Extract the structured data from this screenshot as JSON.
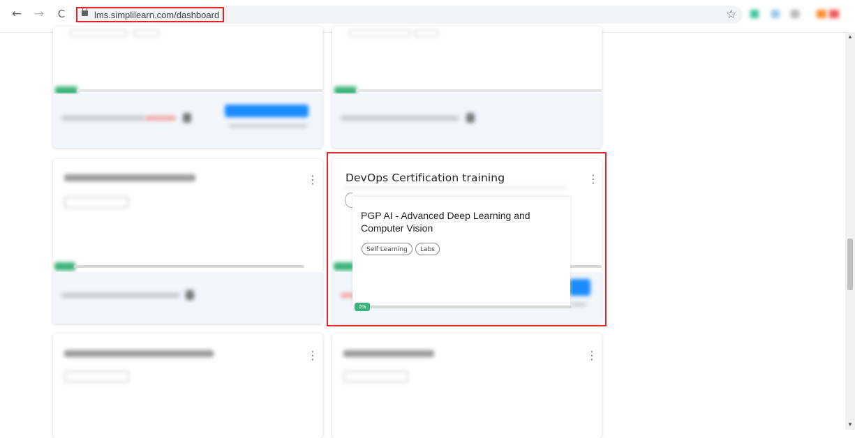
{
  "browser": {
    "url": "lms.simplilearn.com/dashboard",
    "back_icon": "←",
    "forward_icon": "→",
    "reload_icon": "C",
    "star_icon": "☆",
    "highlight_color": "#e0252b"
  },
  "focused_card": {
    "title": "DevOps Certification training",
    "menu_icon": "⋮",
    "popup": {
      "title": "PGP AI - Advanced Deep Learning and Computer Vision",
      "tags": [
        "Self Learning",
        "Labs"
      ],
      "progress_label": "0%",
      "progress": 0
    }
  },
  "blurred_cards_menu_icon": "⋮",
  "colors": {
    "progress_green": "#3bb37a",
    "card_footer": "#f2f6fc",
    "button_blue": "#1a8cff"
  }
}
